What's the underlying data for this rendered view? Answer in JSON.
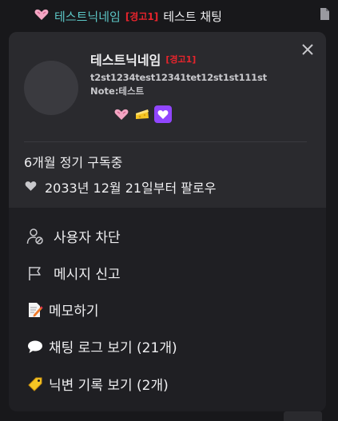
{
  "chat": {
    "nickname": "테스트닉네임",
    "warning": "[경고1]",
    "message": "테스트 채팅"
  },
  "card": {
    "nickname": "테스트닉네임",
    "warning": "[경고1]",
    "user_id": "t2st1234test12341tet12st1st111st",
    "note_label": "Note:",
    "note_value": "테스트",
    "subscription": "6개월 정기 구독중",
    "follow_since": "2033년 12월 21일부터 팔로우"
  },
  "menu": {
    "block": "사용자 차단",
    "report": "메시지 신고",
    "memo": "메모하기",
    "chat_log": "채팅 로그 보기 (21개)",
    "nick_history": "닉변 기록 보기 (2개)"
  },
  "colors": {
    "nickname_teal": "#5cc6c6",
    "warning_red": "#e8242c",
    "card_bg": "#1f1f23",
    "card_top_bg": "#2a2a2e",
    "badge_purple": "#9146ff"
  },
  "icons": [
    "pink-heart-badge-icon",
    "cheese-badge-icon",
    "purple-heart-badge-icon",
    "document-icon",
    "close-icon",
    "heart-icon",
    "user-block-icon",
    "flag-icon",
    "memo-icon",
    "speech-bubble-icon",
    "tag-icon"
  ]
}
